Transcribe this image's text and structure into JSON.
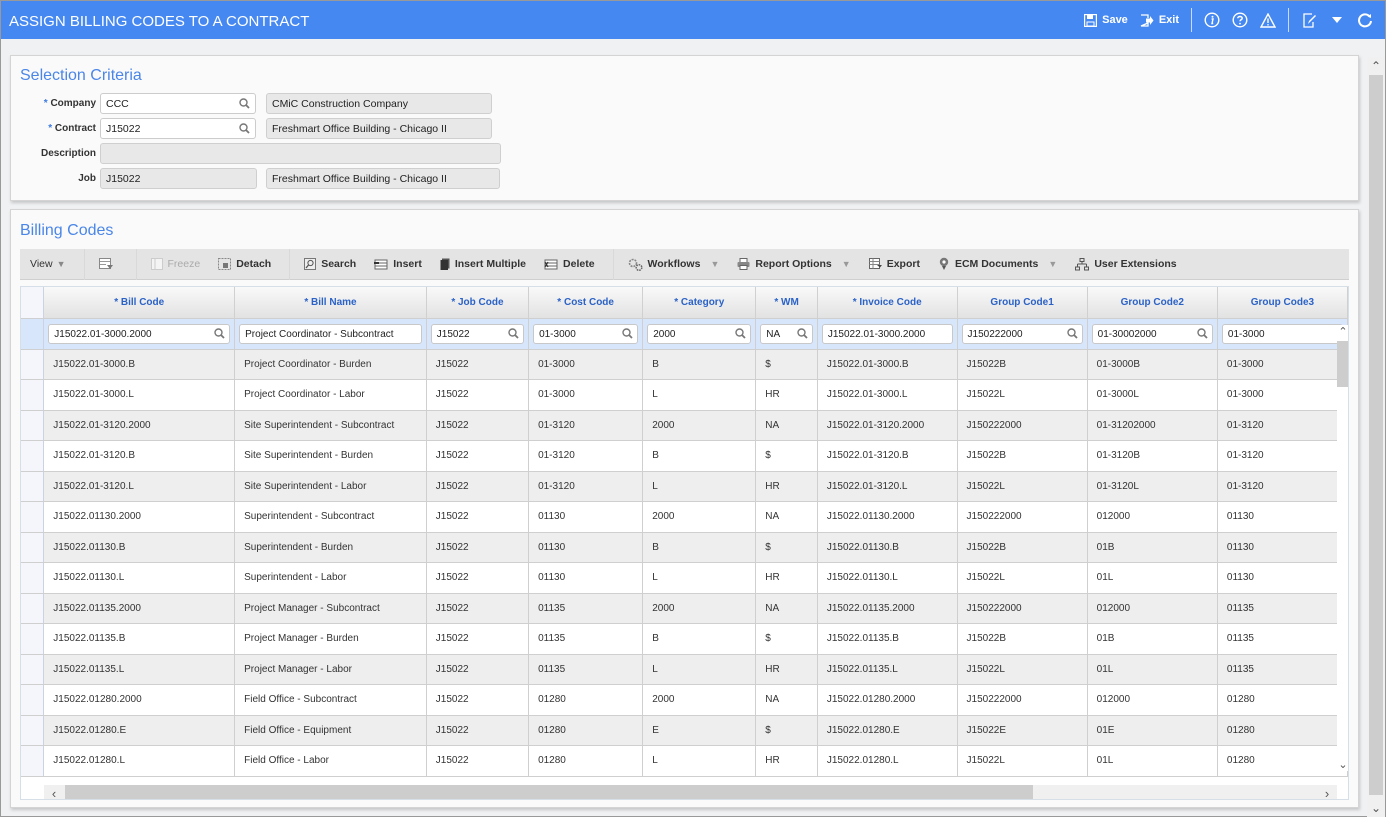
{
  "app": {
    "title": "ASSIGN BILLING CODES TO A CONTRACT",
    "accent_color": "#4688f1",
    "actions": {
      "save_label": "Save",
      "exit_label": "Exit"
    },
    "icons": [
      "save-icon",
      "exit-icon",
      "info-icon",
      "help-icon",
      "warning-icon",
      "edit-icon",
      "dropdown-caret-icon",
      "refresh-icon"
    ]
  },
  "selection": {
    "title": "Selection Criteria",
    "company": {
      "label": "Company",
      "required": "*",
      "value": "CCC",
      "description": "CMiC Construction Company"
    },
    "contract": {
      "label": "Contract",
      "required": "*",
      "value": "J15022",
      "description": "Freshmart Office Building - Chicago II"
    },
    "description": {
      "label": "Description",
      "value": ""
    },
    "job": {
      "label": "Job",
      "value": "J15022",
      "description": "Freshmart Office Building - Chicago II"
    }
  },
  "billing": {
    "title": "Billing Codes",
    "toolbar": {
      "view": "View",
      "freeze": "Freeze",
      "detach": "Detach",
      "search": "Search",
      "insert": "Insert",
      "insert_multiple": "Insert Multiple",
      "delete": "Delete",
      "workflows": "Workflows",
      "report_options": "Report Options",
      "export": "Export",
      "ecm_documents": "ECM Documents",
      "user_extensions": "User Extensions"
    },
    "columns": [
      "* Bill Code",
      "* Bill Name",
      "* Job Code",
      "* Cost Code",
      "* Category",
      "* WM",
      "* Invoice Code",
      "Group Code1",
      "Group Code2",
      "Group Code3"
    ],
    "filter_row": [
      "J15022.01-3000.2000",
      "Project Coordinator - Subcontract",
      "J15022",
      "01-3000",
      "2000",
      "NA",
      "J15022.01-3000.2000",
      "J150222000",
      "01-30002000",
      "01-3000"
    ],
    "rows": [
      [
        "J15022.01-3000.B",
        "Project Coordinator - Burden",
        "J15022",
        "01-3000",
        "B",
        "$",
        "J15022.01-3000.B",
        "J15022B",
        "01-3000B",
        "01-3000"
      ],
      [
        "J15022.01-3000.L",
        "Project Coordinator - Labor",
        "J15022",
        "01-3000",
        "L",
        "HR",
        "J15022.01-3000.L",
        "J15022L",
        "01-3000L",
        "01-3000"
      ],
      [
        "J15022.01-3120.2000",
        "Site Superintendent - Subcontract",
        "J15022",
        "01-3120",
        "2000",
        "NA",
        "J15022.01-3120.2000",
        "J150222000",
        "01-31202000",
        "01-3120"
      ],
      [
        "J15022.01-3120.B",
        "Site Superintendent - Burden",
        "J15022",
        "01-3120",
        "B",
        "$",
        "J15022.01-3120.B",
        "J15022B",
        "01-3120B",
        "01-3120"
      ],
      [
        "J15022.01-3120.L",
        "Site Superintendent - Labor",
        "J15022",
        "01-3120",
        "L",
        "HR",
        "J15022.01-3120.L",
        "J15022L",
        "01-3120L",
        "01-3120"
      ],
      [
        "J15022.01130.2000",
        "Superintendent - Subcontract",
        "J15022",
        "01130",
        "2000",
        "NA",
        "J15022.01130.2000",
        "J150222000",
        "012000",
        "01130"
      ],
      [
        "J15022.01130.B",
        "Superintendent - Burden",
        "J15022",
        "01130",
        "B",
        "$",
        "J15022.01130.B",
        "J15022B",
        "01B",
        "01130"
      ],
      [
        "J15022.01130.L",
        "Superintendent - Labor",
        "J15022",
        "01130",
        "L",
        "HR",
        "J15022.01130.L",
        "J15022L",
        "01L",
        "01130"
      ],
      [
        "J15022.01135.2000",
        "Project Manager - Subcontract",
        "J15022",
        "01135",
        "2000",
        "NA",
        "J15022.01135.2000",
        "J150222000",
        "012000",
        "01135"
      ],
      [
        "J15022.01135.B",
        "Project Manager - Burden",
        "J15022",
        "01135",
        "B",
        "$",
        "J15022.01135.B",
        "J15022B",
        "01B",
        "01135"
      ],
      [
        "J15022.01135.L",
        "Project Manager - Labor",
        "J15022",
        "01135",
        "L",
        "HR",
        "J15022.01135.L",
        "J15022L",
        "01L",
        "01135"
      ],
      [
        "J15022.01280.2000",
        "Field Office - Subcontract",
        "J15022",
        "01280",
        "2000",
        "NA",
        "J15022.01280.2000",
        "J150222000",
        "012000",
        "01280"
      ],
      [
        "J15022.01280.E",
        "Field Office - Equipment",
        "J15022",
        "01280",
        "E",
        "$",
        "J15022.01280.E",
        "J15022E",
        "01E",
        "01280"
      ],
      [
        "J15022.01280.L",
        "Field Office - Labor",
        "J15022",
        "01280",
        "L",
        "HR",
        "J15022.01280.L",
        "J15022L",
        "01L",
        "01280"
      ]
    ]
  }
}
